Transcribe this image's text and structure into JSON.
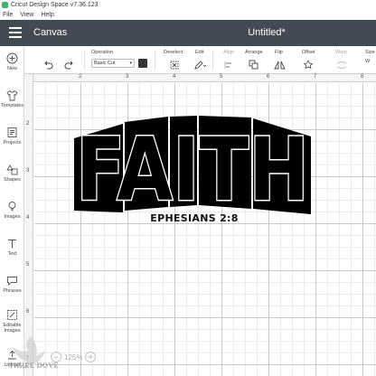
{
  "window": {
    "title": "Cricut Design Space  v7.36.123"
  },
  "menu": {
    "items": [
      "File",
      "View",
      "Help"
    ]
  },
  "header": {
    "section": "Canvas",
    "document_title": "Untitled*"
  },
  "sidebar": {
    "items": [
      {
        "label": "New",
        "icon": "plus-icon"
      },
      {
        "label": "Templates",
        "icon": "shirt-icon"
      },
      {
        "label": "Projects",
        "icon": "projects-icon"
      },
      {
        "label": "Shapes",
        "icon": "shapes-icon"
      },
      {
        "label": "Images",
        "icon": "lightbulb-icon"
      },
      {
        "label": "Text",
        "icon": "text-icon"
      },
      {
        "label": "Phrases",
        "icon": "speech-icon"
      },
      {
        "label": "Editable Images",
        "icon": "editable-images-icon"
      },
      {
        "label": "Upload",
        "icon": "upload-icon"
      }
    ]
  },
  "toolbar": {
    "operation_label": "Operation",
    "operation_value": "Basic Cut",
    "operation_color": "#333333",
    "deselect_label": "Deselect",
    "edit_label": "Edit",
    "align_label": "Align",
    "arrange_label": "Arrange",
    "flip_label": "Flip",
    "offset_label": "Offset",
    "warp_label": "Warp",
    "size_label": "Size"
  },
  "ruler": {
    "top": [
      "2",
      "3",
      "4",
      "5",
      "6",
      "7",
      "8"
    ],
    "left": [
      "2",
      "3",
      "4",
      "5",
      "6",
      "7"
    ]
  },
  "design": {
    "title": "FAITH",
    "verse": "EPHESIANS 2:8"
  },
  "zoom": {
    "value": "125%",
    "minus": "−",
    "plus": "+"
  },
  "watermark": {
    "text": "THREE DOVE"
  },
  "colors": {
    "header_bg": "#434a54",
    "grid_major": "#c9c9c9",
    "grid_minor": "#ececec"
  }
}
